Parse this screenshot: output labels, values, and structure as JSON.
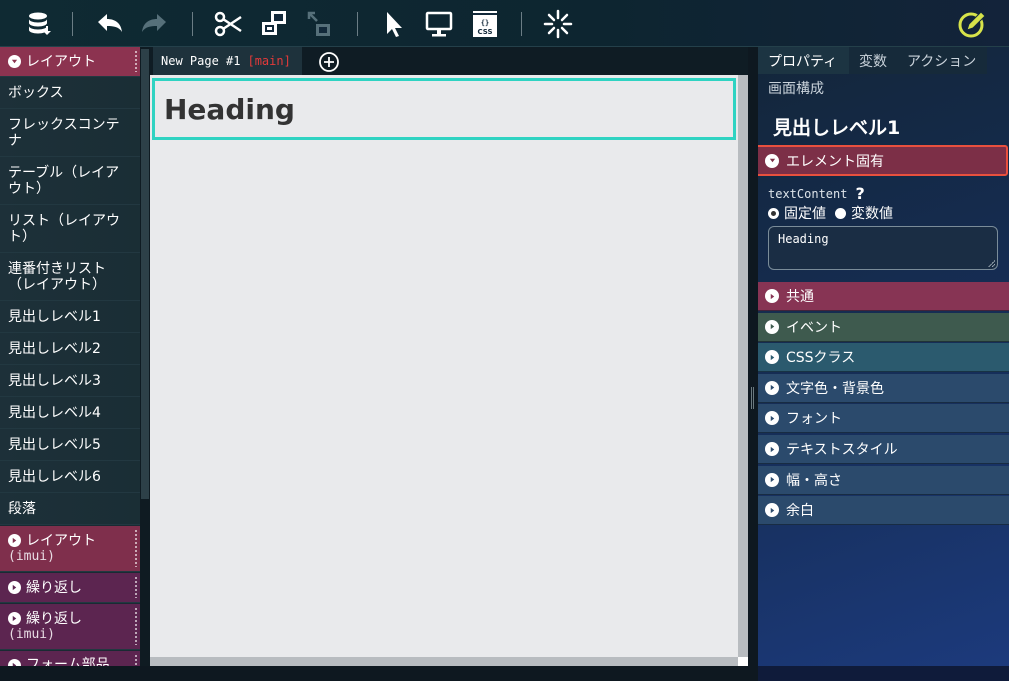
{
  "toolbar": {
    "icons": [
      "database-icon",
      "undo-icon",
      "redo-icon",
      "cut-icon",
      "component-icon",
      "component-disabled-icon",
      "pointer-icon",
      "monitor-icon",
      "css-icon",
      "loading-icon",
      "edit-icon"
    ],
    "css_label": "CSS"
  },
  "palette": {
    "items": [
      {
        "kind": "category",
        "label": "レイアウト",
        "state": "expanded"
      },
      {
        "kind": "item",
        "label": "ボックス"
      },
      {
        "kind": "item",
        "label": "フレックスコンテナ"
      },
      {
        "kind": "item",
        "label": "テーブル（レイアウト）"
      },
      {
        "kind": "item",
        "label": "リスト（レイアウト）"
      },
      {
        "kind": "item",
        "label": "連番付きリスト（レイアウト）"
      },
      {
        "kind": "item",
        "label": "見出しレベル1"
      },
      {
        "kind": "item",
        "label": "見出しレベル2"
      },
      {
        "kind": "item",
        "label": "見出しレベル3"
      },
      {
        "kind": "item",
        "label": "見出しレベル4"
      },
      {
        "kind": "item",
        "label": "見出しレベル5"
      },
      {
        "kind": "item",
        "label": "見出しレベル6"
      },
      {
        "kind": "item",
        "label": "段落"
      },
      {
        "kind": "category",
        "label": "レイアウト",
        "sub": "(imui)",
        "state": "collapsed"
      },
      {
        "kind": "category",
        "label": "繰り返し",
        "state": "collapsed"
      },
      {
        "kind": "category",
        "label": "繰り返し",
        "sub": "(imui)",
        "state": "collapsed"
      },
      {
        "kind": "category",
        "label": "フォーム部品",
        "state": "collapsed"
      }
    ]
  },
  "editor": {
    "tab_label": "New Page #1",
    "tab_branch": "[main]",
    "heading_text": "Heading"
  },
  "right_panel": {
    "tabs": [
      "プロパティ",
      "変数",
      "アクション",
      "画面構成"
    ],
    "active_tab": "プロパティ",
    "title": "見出しレベル1",
    "specific_section": "エレメント固有",
    "prop_name": "textContent",
    "help_glyph": "?",
    "radio_fixed": "固定値",
    "radio_variable": "変数値",
    "radio_selected": "固定値",
    "text_value": "Heading",
    "sections": [
      {
        "label": "共通",
        "color": "#873454"
      },
      {
        "label": "イベント",
        "color": "#3e5a4e"
      },
      {
        "label": "CSSクラス",
        "color": "#2b5a6e"
      },
      {
        "label": "文字色・背景色",
        "color": "#2b4a6c"
      },
      {
        "label": "フォント",
        "color": "#2b4a6c"
      },
      {
        "label": "テキストスタイル",
        "color": "#2b4a6c"
      },
      {
        "label": "幅・高さ",
        "color": "#2b4a6c"
      },
      {
        "label": "余白",
        "color": "#2b4a6c"
      }
    ]
  },
  "colors": {
    "selection": "#2fd3c2",
    "highlight": "#e8503e",
    "branch": "#e23a3a",
    "edit_icon": "#d7e34a"
  }
}
